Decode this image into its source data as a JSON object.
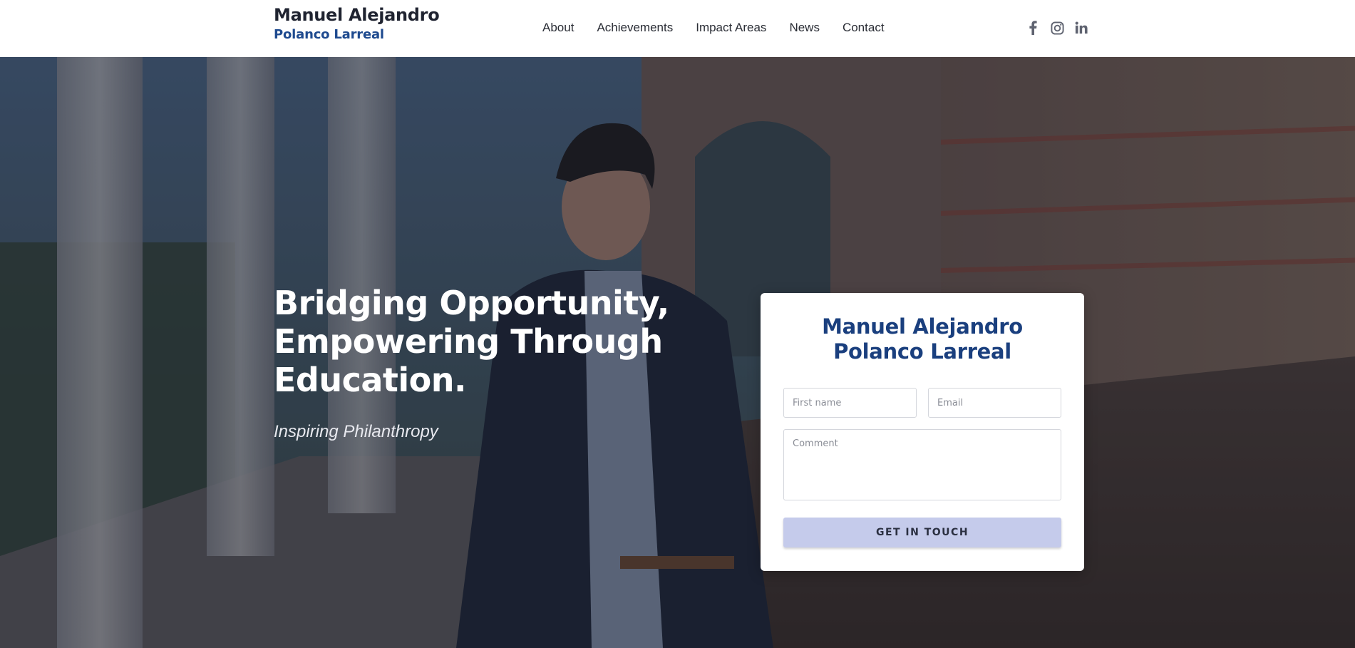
{
  "header": {
    "brand_line1": "Manuel Alejandro",
    "brand_line2": "Polanco Larreal",
    "nav": [
      {
        "label": "About"
      },
      {
        "label": "Achievements"
      },
      {
        "label": "Impact Areas"
      },
      {
        "label": "News"
      },
      {
        "label": "Contact"
      }
    ],
    "social_icons": [
      "facebook-icon",
      "instagram-icon",
      "linkedin-icon"
    ]
  },
  "hero": {
    "title_line1": "Bridging Opportunity,",
    "title_line2": "Empowering Through",
    "title_line3": "Education.",
    "subtitle": "Inspiring Philanthropy"
  },
  "contact_card": {
    "title_line1": "Manuel Alejandro",
    "title_line2": "Polanco Larreal",
    "first_name_placeholder": "First name",
    "email_placeholder": "Email",
    "comment_placeholder": "Comment",
    "submit_label": "GET IN TOUCH"
  },
  "colors": {
    "brand_blue": "#1e4a8f",
    "card_title_blue": "#1a3f7e",
    "button_bg": "#c5cbeb",
    "text_dark": "#1f2330",
    "icon_gray": "#5f6370"
  }
}
